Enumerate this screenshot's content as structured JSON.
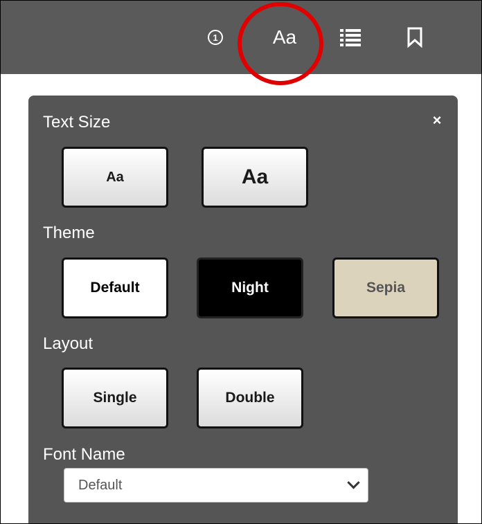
{
  "toolbar": {
    "info_icon_glyph": "1",
    "text_size_label": "Aa",
    "icons": [
      "info-icon",
      "text-size-icon",
      "table-of-contents-icon",
      "bookmark-icon"
    ],
    "highlight_color": "#e10000"
  },
  "panel": {
    "close_glyph": "×",
    "text_size": {
      "label": "Text Size",
      "small": "Aa",
      "large": "Aa"
    },
    "theme": {
      "label": "Theme",
      "options": [
        "Default",
        "Night",
        "Sepia"
      ],
      "colors": {
        "default": "#ffffff",
        "night": "#000000",
        "sepia": "#dcd3bd"
      }
    },
    "layout": {
      "label": "Layout",
      "options": [
        "Single",
        "Double"
      ]
    },
    "font_name": {
      "label": "Font Name",
      "selected": "Default"
    }
  }
}
